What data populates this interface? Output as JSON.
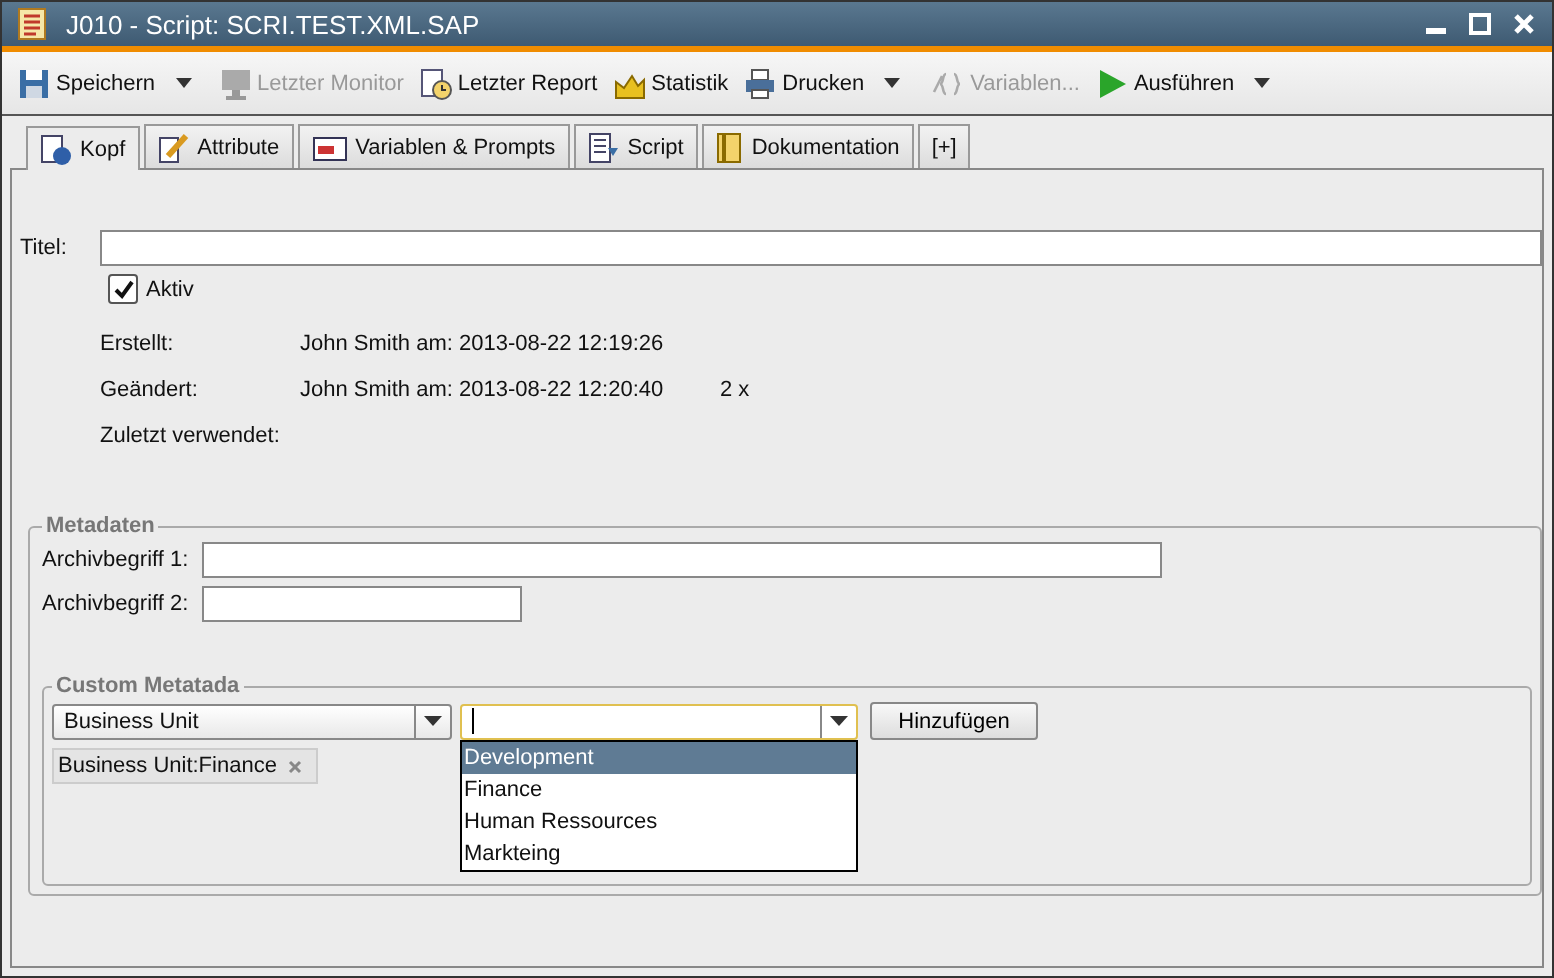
{
  "window": {
    "title": "J010 - Script: SCRI.TEST.XML.SAP"
  },
  "toolbar": [
    {
      "label": "Speichern",
      "disabled": false,
      "dropdown": true
    },
    {
      "label": "Letzter Monitor",
      "disabled": true,
      "dropdown": false
    },
    {
      "label": "Letzter Report",
      "disabled": false,
      "dropdown": false
    },
    {
      "label": "Statistik",
      "disabled": false,
      "dropdown": false
    },
    {
      "label": "Drucken",
      "disabled": false,
      "dropdown": true
    },
    {
      "label": "Variablen...",
      "disabled": true,
      "dropdown": false
    },
    {
      "label": "Ausführen",
      "disabled": false,
      "dropdown": true
    }
  ],
  "tabs": [
    {
      "label": "Kopf",
      "selected": true
    },
    {
      "label": "Attribute",
      "selected": false
    },
    {
      "label": "Variablen & Prompts",
      "selected": false
    },
    {
      "label": "Script",
      "selected": false
    },
    {
      "label": "Dokumentation",
      "selected": false
    },
    {
      "label": "[+]",
      "selected": false
    }
  ],
  "header": {
    "title_label": "Titel:",
    "active": {
      "label": "Aktiv",
      "checked": true
    },
    "info": [
      {
        "label": "Erstellt:",
        "value": "John Smith am: 2013-08-22 12:19:26"
      },
      {
        "label": "Geändert:",
        "value": "John Smith am: 2013-08-22 12:20:40",
        "count": "2 x"
      },
      {
        "label": "Zuletzt verwendet:"
      }
    ]
  },
  "metadata": {
    "legend": "Metadaten",
    "fields": [
      {
        "label": "Archivbegriff 1:"
      },
      {
        "label": "Archivbegriff 2:"
      }
    ]
  },
  "custom_metadata": {
    "legend": "Custom Metatada",
    "key_select": "Business Unit",
    "add_button": "Hinzufügen",
    "options": [
      {
        "label": "Development",
        "selected": true
      },
      {
        "label": "Finance",
        "selected": false
      },
      {
        "label": "Human Ressources",
        "selected": false
      },
      {
        "label": "Markteing",
        "selected": false
      }
    ],
    "tags": [
      {
        "label": "Business Unit:Finance"
      }
    ]
  }
}
